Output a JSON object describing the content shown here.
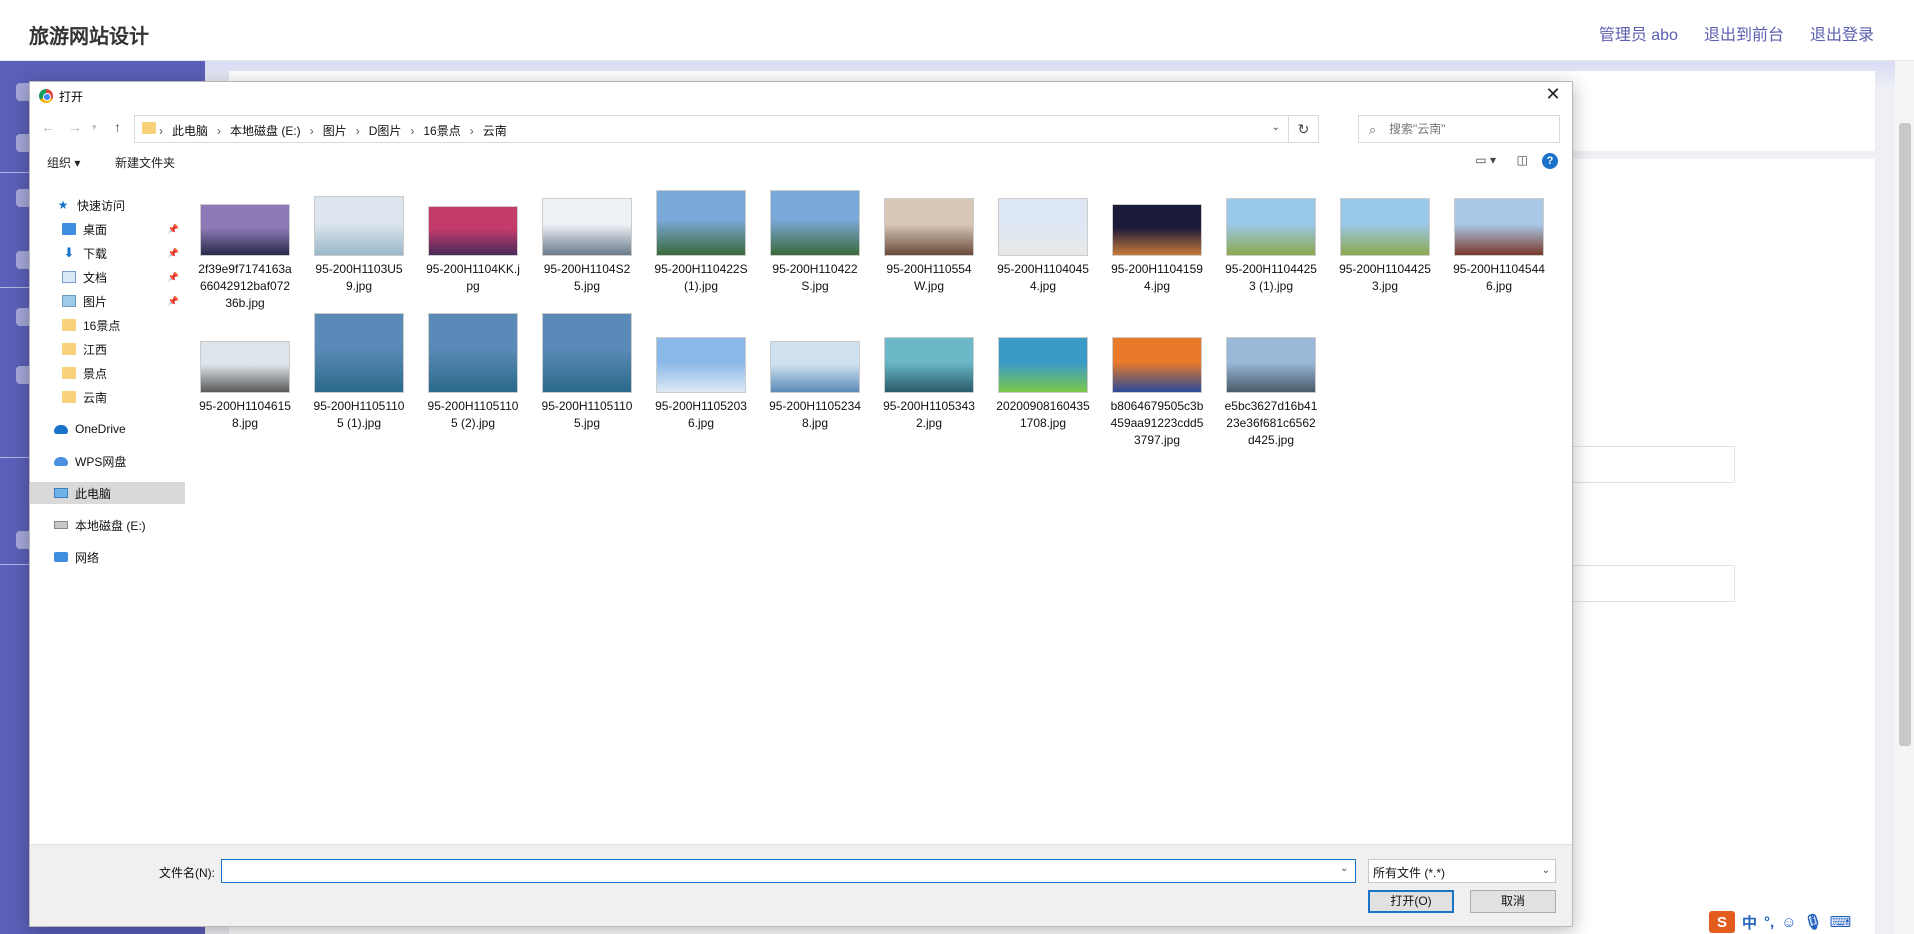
{
  "app": {
    "title": "旅游网站设计",
    "header_links": [
      "管理员 abo",
      "退出到前台",
      "退出登录"
    ]
  },
  "dialog": {
    "title": "打开",
    "close_label": "✕",
    "breadcrumbs": [
      "此电脑",
      "本地磁盘 (E:)",
      "图片",
      "D图片",
      "16景点",
      "云南"
    ],
    "search_placeholder": "搜索\"云南\"",
    "toolbar": {
      "organize": "组织 ▾",
      "new_folder": "新建文件夹",
      "help": "?"
    },
    "nav": [
      {
        "label": "快速访问",
        "icon": "star-icon"
      },
      {
        "label": "桌面",
        "icon": "desktop-icon",
        "pinned": true
      },
      {
        "label": "下载",
        "icon": "download-icon",
        "pinned": true
      },
      {
        "label": "文档",
        "icon": "document-icon",
        "pinned": true
      },
      {
        "label": "图片",
        "icon": "pictures-icon",
        "pinned": true
      },
      {
        "label": "16景点",
        "icon": "folder-icon"
      },
      {
        "label": "江西",
        "icon": "folder-icon"
      },
      {
        "label": "景点",
        "icon": "folder-icon"
      },
      {
        "label": "云南",
        "icon": "folder-icon"
      },
      {
        "label": "OneDrive",
        "icon": "onedrive-icon"
      },
      {
        "label": "WPS网盘",
        "icon": "wps-cloud-icon"
      },
      {
        "label": "此电脑",
        "icon": "this-pc-icon",
        "selected": true
      },
      {
        "label": "本地磁盘 (E:)",
        "icon": "drive-icon"
      },
      {
        "label": "网络",
        "icon": "network-icon"
      }
    ],
    "files": [
      {
        "name": "2f39e9f7174163a66042912baf07236b.jpg",
        "colors": [
          "#8f7ab8",
          "#2a2a4a"
        ]
      },
      {
        "name": "95-200H1103U59.jpg",
        "colors": [
          "#dde6ee",
          "#9ab8c8"
        ]
      },
      {
        "name": "95-200H1104KK.jpg",
        "colors": [
          "#c43a6a",
          "#4a2a5a"
        ]
      },
      {
        "name": "95-200H1104S25.jpg",
        "colors": [
          "#eef2f6",
          "#6a7a8a"
        ]
      },
      {
        "name": "95-200H110422S (1).jpg",
        "colors": [
          "#7aa8d8",
          "#3a6a3a"
        ]
      },
      {
        "name": "95-200H110422S.jpg",
        "colors": [
          "#7aa8d8",
          "#3a6a3a"
        ]
      },
      {
        "name": "95-200H110554W.jpg",
        "colors": [
          "#d8c8b8",
          "#6a4a3a"
        ]
      },
      {
        "name": "95-200H11040454.jpg",
        "colors": [
          "#dde8f4",
          "#e8e8e8"
        ]
      },
      {
        "name": "95-200H11041594.jpg",
        "colors": [
          "#1a1a3a",
          "#c87a3a"
        ]
      },
      {
        "name": "95-200H11044253 (1).jpg",
        "colors": [
          "#9ac8e8",
          "#8aa84a"
        ]
      },
      {
        "name": "95-200H11044253.jpg",
        "colors": [
          "#9ac8e8",
          "#8aa84a"
        ]
      },
      {
        "name": "95-200H11045446.jpg",
        "colors": [
          "#a8c8e8",
          "#7a3a2a"
        ]
      },
      {
        "name": "95-200H11046158.jpg",
        "colors": [
          "#dde4ea",
          "#5a5a5a"
        ]
      },
      {
        "name": "95-200H11051105 (1).jpg",
        "colors": [
          "#5a8ab8",
          "#2a6a8a"
        ]
      },
      {
        "name": "95-200H11051105 (2).jpg",
        "colors": [
          "#5a8ab8",
          "#2a6a8a"
        ]
      },
      {
        "name": "95-200H11051105.jpg",
        "colors": [
          "#5a8ab8",
          "#2a6a8a"
        ]
      },
      {
        "name": "95-200H11052036.jpg",
        "colors": [
          "#8ab8e8",
          "#dde8f4"
        ]
      },
      {
        "name": "95-200H11052348.jpg",
        "colors": [
          "#cfe0ee",
          "#5a8ab8"
        ]
      },
      {
        "name": "95-200H11053432.jpg",
        "colors": [
          "#6ab8c8",
          "#2a5a6a"
        ]
      },
      {
        "name": "202009081604351708.jpg",
        "colors": [
          "#3a9ac8",
          "#7ac84a"
        ]
      },
      {
        "name": "b8064679505c3b459aa91223cdd53797.jpg",
        "colors": [
          "#e87a2a",
          "#2a4a9a"
        ]
      },
      {
        "name": "e5bc3627d16b4123e36f681c6562d425.jpg",
        "colors": [
          "#9ab8d8",
          "#4a5a6a"
        ]
      }
    ],
    "filename_label": "文件名(N):",
    "filename_value": "",
    "filetype": "所有文件 (*.*)",
    "open_button": "打开(O)",
    "cancel_button": "取消"
  },
  "tray": {
    "s_label": "S",
    "items": [
      "中",
      "°,",
      "☺",
      "🎙",
      "⌨"
    ]
  }
}
